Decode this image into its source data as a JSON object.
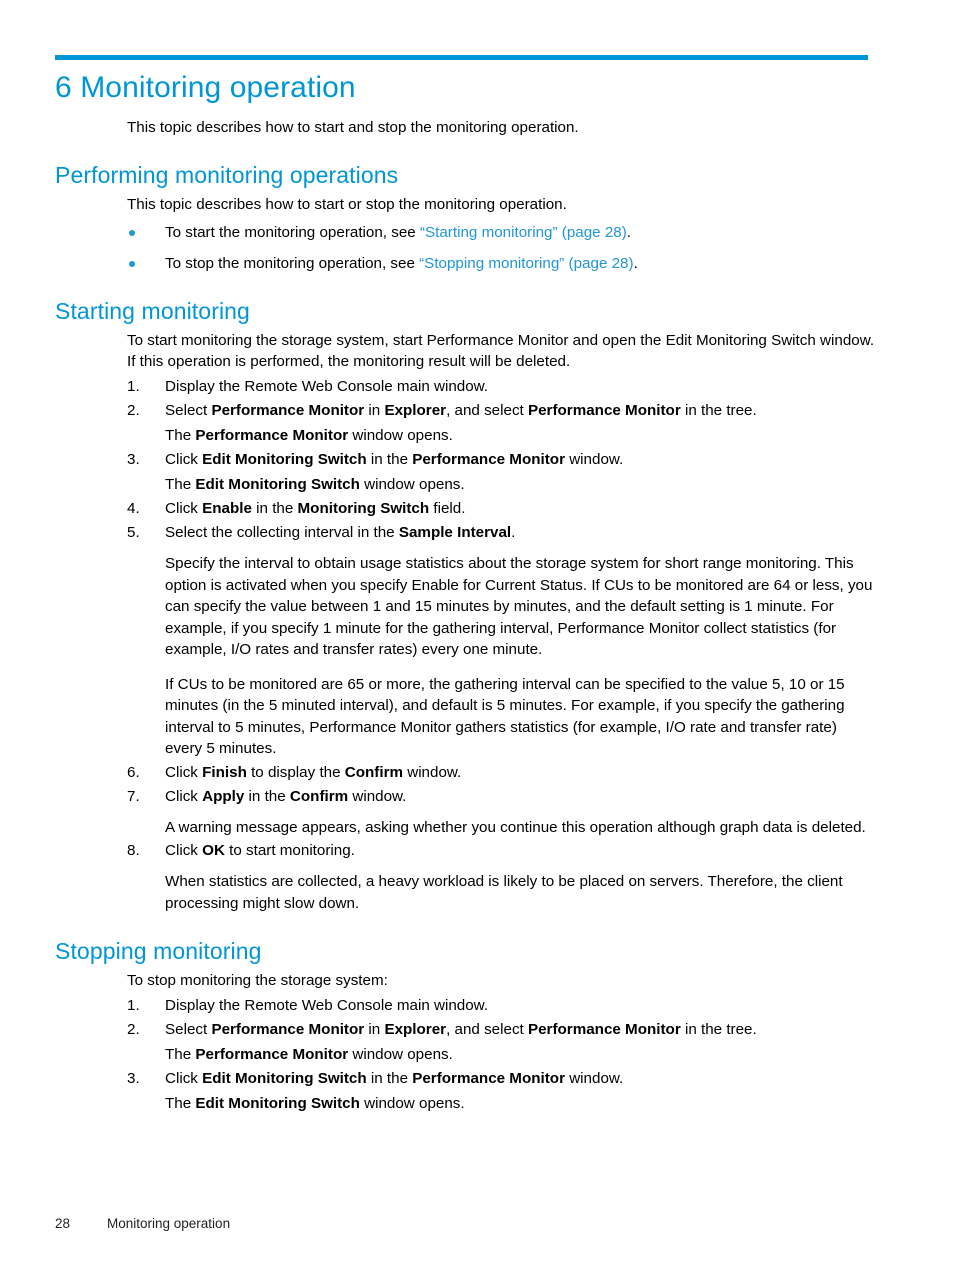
{
  "theme": {
    "accent": "#0096d6",
    "link": "#2196d6",
    "text": "#000000",
    "background": "#ffffff"
  },
  "chapter": {
    "title": "6 Monitoring operation",
    "intro": "This topic describes how to start and stop the monitoring operation."
  },
  "sections": [
    {
      "id": "performing-monitoring-operations",
      "title": "Performing monitoring operations",
      "intro": "This topic describes how to start or stop the monitoring operation.",
      "bullets": [
        {
          "prefix": "To start the monitoring operation, see ",
          "link": "“Starting monitoring” (page 28)",
          "suffix": "."
        },
        {
          "prefix": "To stop the monitoring operation, see ",
          "link": "“Stopping monitoring” (page 28)",
          "suffix": "."
        }
      ]
    },
    {
      "id": "starting-monitoring",
      "title": "Starting monitoring",
      "intro": "To start monitoring the storage system, start Performance Monitor and open the Edit Monitoring Switch window. If this operation is performed, the monitoring result will be deleted.",
      "steps": [
        {
          "num": "1.",
          "text": "Display the Remote Web Console main window."
        },
        {
          "num": "2.",
          "text_parts": [
            {
              "t": "Select ",
              "b": false
            },
            {
              "t": "Performance Monitor",
              "b": true
            },
            {
              "t": " in ",
              "b": false
            },
            {
              "t": "Explorer",
              "b": true
            },
            {
              "t": ", and select ",
              "b": false
            },
            {
              "t": "Performance Monitor",
              "b": true
            },
            {
              "t": " in the tree.",
              "b": false
            }
          ],
          "sub_parts": [
            {
              "t": "The ",
              "b": false
            },
            {
              "t": "Performance Monitor",
              "b": true
            },
            {
              "t": " window opens.",
              "b": false
            }
          ]
        },
        {
          "num": "3.",
          "text_parts": [
            {
              "t": "Click ",
              "b": false
            },
            {
              "t": "Edit Monitoring Switch",
              "b": true
            },
            {
              "t": " in the ",
              "b": false
            },
            {
              "t": "Performance Monitor",
              "b": true
            },
            {
              "t": " window.",
              "b": false
            }
          ],
          "sub_parts": [
            {
              "t": "The ",
              "b": false
            },
            {
              "t": "Edit Monitoring Switch",
              "b": true
            },
            {
              "t": " window opens.",
              "b": false
            }
          ]
        },
        {
          "num": "4.",
          "text_parts": [
            {
              "t": "Click ",
              "b": false
            },
            {
              "t": "Enable",
              "b": true
            },
            {
              "t": " in the ",
              "b": false
            },
            {
              "t": "Monitoring Switch",
              "b": true
            },
            {
              "t": " field.",
              "b": false
            }
          ]
        },
        {
          "num": "5.",
          "text_parts": [
            {
              "t": "Select the collecting interval in the ",
              "b": false
            },
            {
              "t": "Sample Interval",
              "b": true
            },
            {
              "t": ".",
              "b": false
            }
          ],
          "blocks": [
            "Specify the interval to obtain usage statistics about the storage system for short range monitoring. This option is activated when you specify Enable for Current Status. If CUs to be monitored are 64 or less, you can specify the value between 1 and 15 minutes by minutes, and the default setting is 1 minute. For example, if you specify 1 minute for the gathering interval, Performance Monitor collect statistics (for example, I/O rates and transfer rates) every one minute.",
            "If CUs to be monitored are 65 or more, the gathering interval can be specified to the value 5, 10 or 15 minutes (in the 5 minuted interval), and default is 5 minutes. For example, if you specify the gathering interval to 5 minutes, Performance Monitor gathers statistics (for example, I/O rate and transfer rate) every 5 minutes."
          ]
        },
        {
          "num": "6.",
          "text_parts": [
            {
              "t": "Click ",
              "b": false
            },
            {
              "t": "Finish",
              "b": true
            },
            {
              "t": " to display the ",
              "b": false
            },
            {
              "t": "Confirm",
              "b": true
            },
            {
              "t": " window.",
              "b": false
            }
          ]
        },
        {
          "num": "7.",
          "text_parts": [
            {
              "t": "Click ",
              "b": false
            },
            {
              "t": "Apply",
              "b": true
            },
            {
              "t": " in the ",
              "b": false
            },
            {
              "t": "Confirm",
              "b": true
            },
            {
              "t": " window.",
              "b": false
            }
          ],
          "blocks": [
            "A warning message appears, asking whether you continue this operation although graph data is deleted."
          ]
        },
        {
          "num": "8.",
          "text_parts": [
            {
              "t": "Click ",
              "b": false
            },
            {
              "t": "OK",
              "b": true
            },
            {
              "t": " to start monitoring.",
              "b": false
            }
          ],
          "blocks": [
            "When statistics are collected, a heavy workload is likely to be placed on servers. Therefore, the client processing might slow down."
          ]
        }
      ]
    },
    {
      "id": "stopping-monitoring",
      "title": "Stopping monitoring",
      "intro": "To stop monitoring the storage system:",
      "steps": [
        {
          "num": "1.",
          "text": "Display the Remote Web Console main window."
        },
        {
          "num": "2.",
          "text_parts": [
            {
              "t": "Select ",
              "b": false
            },
            {
              "t": "Performance Monitor",
              "b": true
            },
            {
              "t": " in ",
              "b": false
            },
            {
              "t": "Explorer",
              "b": true
            },
            {
              "t": ", and select ",
              "b": false
            },
            {
              "t": "Performance Monitor",
              "b": true
            },
            {
              "t": " in the tree.",
              "b": false
            }
          ],
          "sub_parts": [
            {
              "t": "The ",
              "b": false
            },
            {
              "t": "Performance Monitor",
              "b": true
            },
            {
              "t": " window opens.",
              "b": false
            }
          ]
        },
        {
          "num": "3.",
          "text_parts": [
            {
              "t": "Click ",
              "b": false
            },
            {
              "t": "Edit Monitoring Switch",
              "b": true
            },
            {
              "t": " in the ",
              "b": false
            },
            {
              "t": "Performance Monitor",
              "b": true
            },
            {
              "t": " window.",
              "b": false
            }
          ],
          "sub_parts": [
            {
              "t": "The ",
              "b": false
            },
            {
              "t": "Edit Monitoring Switch",
              "b": true
            },
            {
              "t": " window opens.",
              "b": false
            }
          ]
        }
      ]
    }
  ],
  "footer": {
    "page_number": "28",
    "running_title": "Monitoring operation"
  }
}
